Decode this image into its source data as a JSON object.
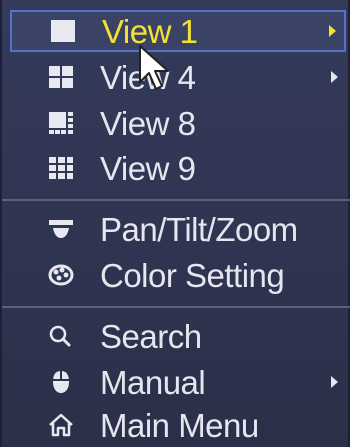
{
  "menu": {
    "items": [
      {
        "label": "View 1",
        "icon": "single-square-icon",
        "submenu": true,
        "selected": true
      },
      {
        "label": "View 4",
        "icon": "four-grid-icon",
        "submenu": true,
        "selected": false
      },
      {
        "label": "View 8",
        "icon": "eight-grid-icon",
        "submenu": false,
        "selected": false
      },
      {
        "label": "View 9",
        "icon": "nine-grid-icon",
        "submenu": false,
        "selected": false
      },
      {
        "label": "Pan/Tilt/Zoom",
        "icon": "ptz-camera-icon",
        "submenu": false,
        "selected": false
      },
      {
        "label": "Color Setting",
        "icon": "color-palette-icon",
        "submenu": false,
        "selected": false
      },
      {
        "label": "Search",
        "icon": "search-icon",
        "submenu": false,
        "selected": false
      },
      {
        "label": "Manual",
        "icon": "mouse-icon",
        "submenu": true,
        "selected": false
      },
      {
        "label": "Main Menu",
        "icon": "home-icon",
        "submenu": false,
        "selected": false
      }
    ]
  },
  "colors": {
    "background": "#2e3350",
    "text": "#e6e6ee",
    "selected_text": "#f4e233",
    "selected_border": "#5671c8",
    "separator": "#5a6182"
  }
}
